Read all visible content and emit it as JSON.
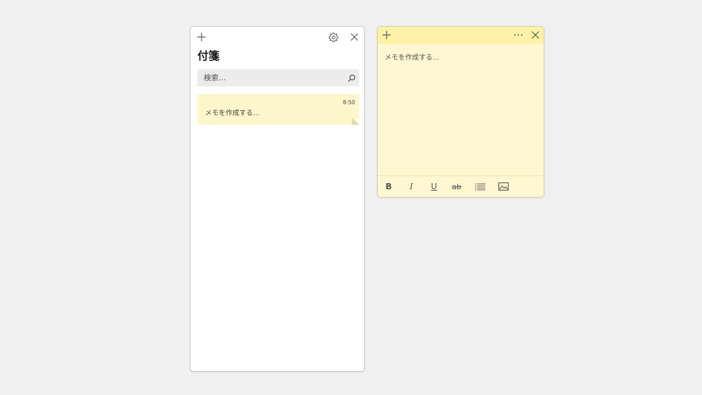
{
  "list_window": {
    "title": "付箋",
    "search": {
      "placeholder": "検索...",
      "value": ""
    },
    "notes": [
      {
        "time": "8:50",
        "preview": "メモを作成する..."
      }
    ],
    "icons": {
      "add": "plus-icon",
      "settings": "gear-icon",
      "close": "close-icon",
      "search": "search-icon"
    }
  },
  "note_window": {
    "body_placeholder": "メモを作成する...",
    "toolbar": {
      "bold": "B",
      "italic": "I",
      "underline": "U",
      "strikethrough": "ab",
      "list": "bulleted-list-icon",
      "image": "image-icon"
    },
    "icons": {
      "add": "plus-icon",
      "more": "more-icon",
      "close": "close-icon"
    }
  },
  "colors": {
    "desktop_bg": "#f0f0f0",
    "note_bg": "#fff7d1",
    "note_header_bg": "#fff1a8",
    "note_card_bg": "#fff7cc"
  }
}
